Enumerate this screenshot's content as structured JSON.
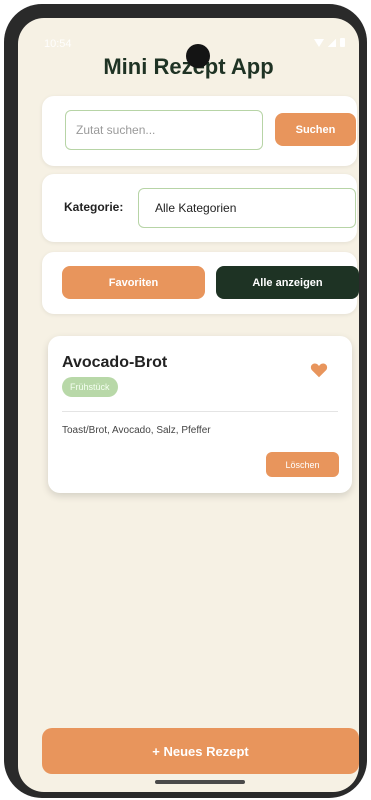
{
  "status_bar": {
    "time": "10:54"
  },
  "app": {
    "title": "Mini Rezept App"
  },
  "search": {
    "placeholder": "Zutat suchen...",
    "value": "",
    "button_label": "Suchen"
  },
  "category": {
    "label": "Kategorie:",
    "selected": "Alle Kategorien"
  },
  "filters": {
    "favorites_label": "Favoriten",
    "show_all_label": "Alle anzeigen"
  },
  "recipes": [
    {
      "title": "Avocado-Brot",
      "category": "Frühstück",
      "ingredients": "Toast/Brot, Avocado, Salz, Pfeffer",
      "favorite": true,
      "delete_label": "Löschen"
    }
  ],
  "actions": {
    "new_recipe_label": "+ Neues Rezept"
  },
  "colors": {
    "background": "#f6f1e4",
    "accent_orange": "#e8955c",
    "dark_green": "#1e3324",
    "light_green": "#b7d4a6"
  }
}
